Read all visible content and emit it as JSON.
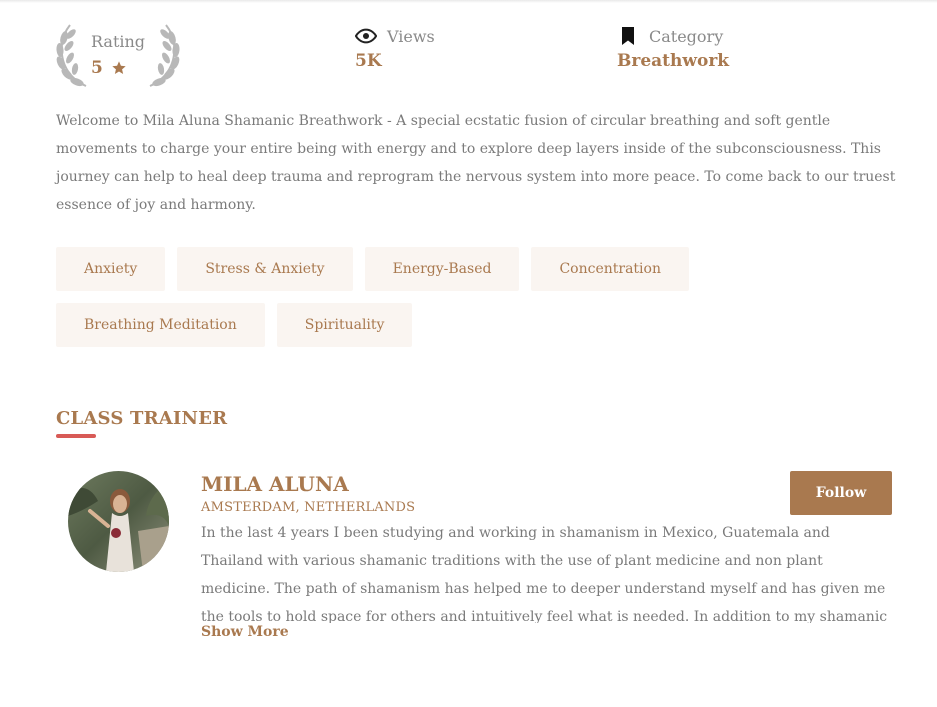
{
  "stats": {
    "rating": {
      "label": "Rating",
      "value": "5",
      "icon": "star-icon"
    },
    "views": {
      "label": "Views",
      "value": "5K",
      "icon": "eye-icon"
    },
    "category": {
      "label": "Category",
      "value": "Breathwork",
      "icon": "bookmark-icon"
    }
  },
  "description": "Welcome to Mila Aluna Shamanic Breathwork - A special ecstatic fusion of circular breathing and soft gentle movements to charge your entire being with energy and to explore deep layers inside of the subconsciousness. This journey can help to heal deep trauma and reprogram the nervous system into more peace. To come back to our truest essence of joy and harmony.",
  "tags": [
    "Anxiety",
    "Stress & Anxiety",
    "Energy-Based",
    "Concentration",
    "Breathing Meditation",
    "Spirituality"
  ],
  "trainer_section": {
    "title": "CLASS TRAINER",
    "name": "MILA ALUNA",
    "location": "AMSTERDAM, NETHERLANDS",
    "follow_label": "Follow",
    "bio": "In the last 4 years I been studying and working in shamanism in Mexico, Guatemala and Thailand with various shamanic traditions with the use of plant medicine and non plant medicine. The path of shamanism has helped me to deeper understand myself and has given me the tools to hold space for others and intuitively feel what is needed. In addition to my shamanic background, I has been",
    "show_more_label": "Show More"
  },
  "colors": {
    "accent": "#a9794f",
    "tag_bg": "#faf5f1",
    "underline": "#d85a56",
    "text": "#7a7a7a"
  }
}
